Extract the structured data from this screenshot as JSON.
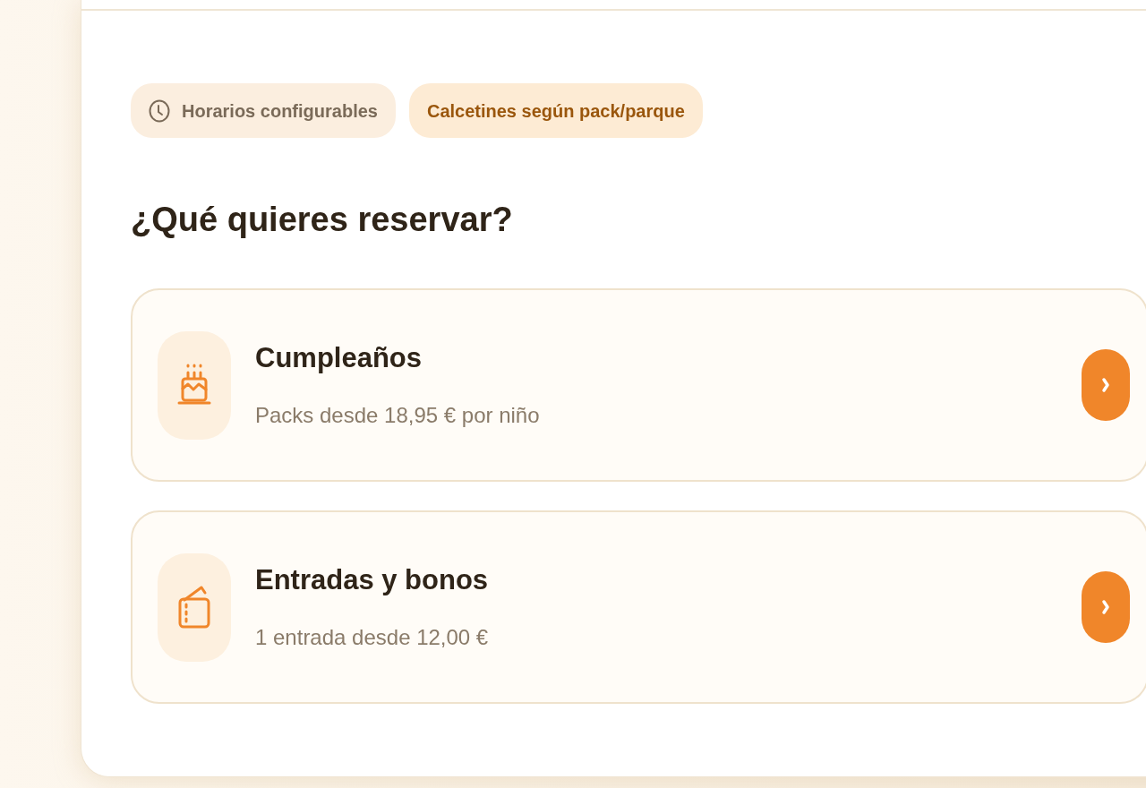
{
  "tags": [
    {
      "kind": "neutral",
      "label": "Horarios configurables"
    },
    {
      "kind": "accent",
      "label": "Calcetines según pack/parque"
    }
  ],
  "heading": "¿Qué quieres reservar?",
  "options": [
    {
      "kind": "birthday",
      "title": "Cumpleaños",
      "subtitle": "Packs desde 18,95 € por niño"
    },
    {
      "kind": "tickets",
      "title": "Entradas y bonos",
      "subtitle": "1 entrada desde 12,00 €"
    }
  ]
}
